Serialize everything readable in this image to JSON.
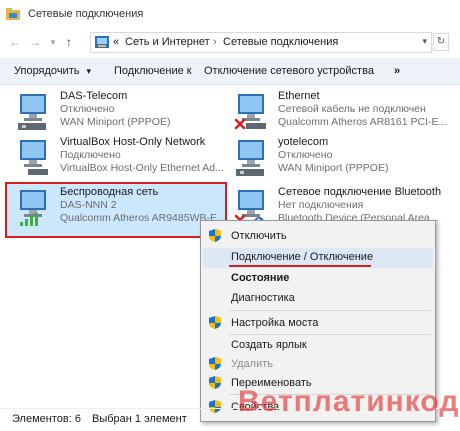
{
  "window": {
    "title": "Сетевые подключения"
  },
  "address": {
    "crumb_root": "«",
    "crumb_1": "Сеть и Интернет",
    "crumb_sep": "›",
    "crumb_2": "Сетевые подключения"
  },
  "toolbar": {
    "organize": "Упорядочить",
    "organize_caret": "▾",
    "connect": "Подключение к",
    "disable": "Отключение сетевого устройства",
    "more": "»"
  },
  "connections": [
    {
      "name": "DAS-Telecom",
      "status": "Отключено",
      "device": "WAN Miniport (PPPOE)",
      "error": false
    },
    {
      "name": "Ethernet",
      "status": "Сетевой кабель не подключен",
      "device": "Qualcomm Atheros AR8161 PCI-E...",
      "error": true
    },
    {
      "name": "VirtualBox Host-Only Network",
      "status": "Подключено",
      "device": "VirtualBox Host-Only Ethernet Ad...",
      "error": false
    },
    {
      "name": "yotelecom",
      "status": "Отключено",
      "device": "WAN Miniport (PPPOE)",
      "error": false
    },
    {
      "name": "Беспроводная сеть",
      "status": "DAS-NNN  2",
      "device": "Qualcomm Atheros AR9485WB-E",
      "error": false
    },
    {
      "name": "Сетевое подключение Bluetooth",
      "status": "Нет подключения",
      "device": "Bluetooth Device (Personal Area...",
      "error": true
    }
  ],
  "context_menu": {
    "items": [
      {
        "label": "Отключить",
        "shield": true,
        "disabled": false,
        "bold": false
      },
      {
        "label": "Подключение / Отключение",
        "shield": false,
        "disabled": false,
        "bold": false
      },
      {
        "label": "Состояние",
        "shield": false,
        "disabled": false,
        "bold": true
      },
      {
        "label": "Диагностика",
        "shield": false,
        "disabled": false,
        "bold": false
      },
      {
        "label": "Настройка моста",
        "shield": true,
        "disabled": false,
        "bold": false
      },
      {
        "label": "Создать ярлык",
        "shield": false,
        "disabled": false,
        "bold": false
      },
      {
        "label": "Удалить",
        "shield": true,
        "disabled": true,
        "bold": false
      },
      {
        "label": "Переименовать",
        "shield": true,
        "disabled": false,
        "bold": false
      },
      {
        "label": "Свойства",
        "shield": true,
        "disabled": false,
        "bold": false
      }
    ]
  },
  "status_bar": {
    "count": "Элементов: 6",
    "selected": "Выбран 1 элемент"
  },
  "watermark": "Ветплатинкод",
  "colors": {
    "accent": "#d81e1e",
    "selection": "#cce8ff",
    "toolbar": "#eef3f9",
    "shield_blue": "#1f6fd1",
    "shield_yellow": "#f2c200"
  }
}
